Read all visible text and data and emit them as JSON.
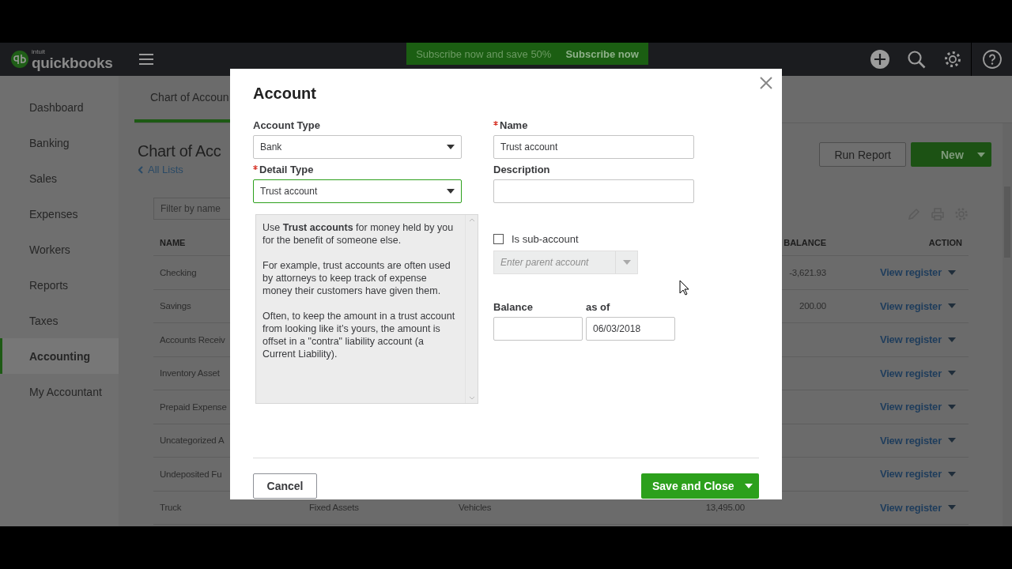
{
  "header": {
    "logo_small": "intuit",
    "logo": "quickbooks",
    "promo": {
      "text": "Subscribe now and save 50%",
      "action": "Subscribe now"
    }
  },
  "sidebar": {
    "items": [
      {
        "label": "Dashboard",
        "selected": false
      },
      {
        "label": "Banking",
        "selected": false
      },
      {
        "label": "Sales",
        "selected": false
      },
      {
        "label": "Expenses",
        "selected": false
      },
      {
        "label": "Workers",
        "selected": false
      },
      {
        "label": "Reports",
        "selected": false
      },
      {
        "label": "Taxes",
        "selected": false
      },
      {
        "label": "Accounting",
        "selected": true
      },
      {
        "label": "My Accountant",
        "selected": false
      }
    ]
  },
  "tabs": [
    {
      "label": "Chart of Accoun",
      "selected": true
    }
  ],
  "page": {
    "title": "Chart of Acc",
    "back_link": "All Lists",
    "buttons": {
      "run_report": "Run Report",
      "new": "New"
    },
    "filter": {
      "placeholder": "Filter by name"
    }
  },
  "table": {
    "columns": [
      "NAME",
      "",
      "",
      "",
      "BALANCE",
      "ACTION"
    ],
    "rows": [
      {
        "cells": [
          "Checking",
          "",
          "",
          "",
          "-3,621.93"
        ],
        "action": "View register"
      },
      {
        "cells": [
          "Savings",
          "",
          "",
          "",
          "200.00"
        ],
        "action": "View register"
      },
      {
        "cells": [
          "Accounts Receiv",
          "",
          "",
          "",
          ""
        ],
        "action": "View register"
      },
      {
        "cells": [
          "Inventory Asset",
          "",
          "",
          "",
          ""
        ],
        "action": "View register"
      },
      {
        "cells": [
          "Prepaid Expense",
          "",
          "",
          "",
          ""
        ],
        "action": "View register"
      },
      {
        "cells": [
          "Uncategorized A",
          "",
          "",
          "",
          ""
        ],
        "action": "View register"
      },
      {
        "cells": [
          "Undeposited Fu",
          "",
          "",
          "",
          ""
        ],
        "action": "View register"
      },
      {
        "cells": [
          "Truck",
          "Fixed Assets",
          "Vehicles",
          "13,495.00",
          ""
        ],
        "action": "View register"
      }
    ]
  },
  "modal": {
    "title": "Account",
    "account_type": {
      "label": "Account Type",
      "required": false,
      "value": "Bank",
      "focused": false
    },
    "detail_type": {
      "label": "Detail Type",
      "required": true,
      "value": "Trust account",
      "focused": true
    },
    "name": {
      "label": "Name",
      "required": true,
      "value": "Trust account"
    },
    "description": {
      "label": "Description",
      "required": false
    },
    "help": [
      "Use **Trust accounts** for money held by you for the benefit of someone else.",
      "For example, trust accounts are often used by attorneys to keep track of expense money their customers have given them.",
      "Often, to keep the amount in a trust account from looking like it’s yours, the amount is offset in a \"contra\" liability account (a Current Liability)."
    ],
    "sub_account": {
      "label": "Is sub-account",
      "checked": false,
      "placeholder": "Enter parent account"
    },
    "balance": {
      "label": "Balance"
    },
    "as_of": {
      "label": "as of",
      "value": "06/03/2018"
    },
    "cancel": "Cancel",
    "save": "Save and Close"
  }
}
